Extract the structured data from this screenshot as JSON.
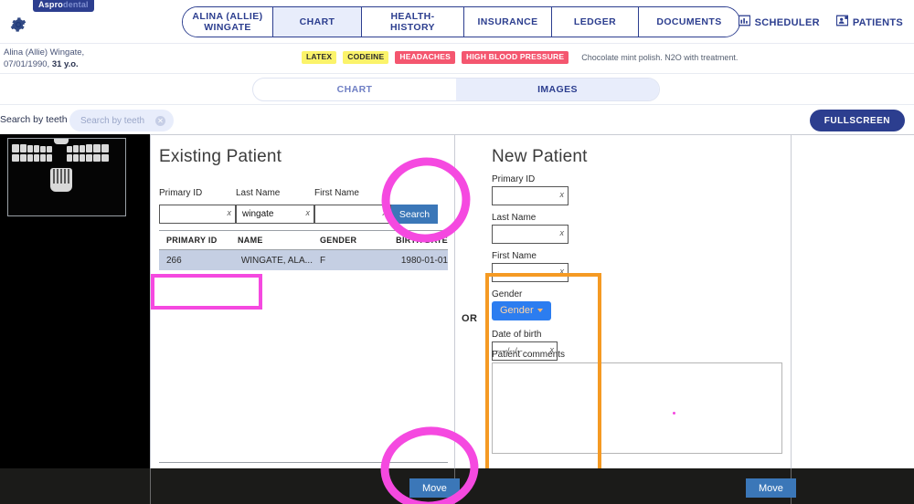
{
  "app": {
    "logo_bold": "Aspro",
    "logo_light": "dental"
  },
  "topnav": {
    "gear_icon": "gear-icon",
    "tabs": [
      {
        "label": "ALINA (ALLIE)\nWINGATE",
        "active": false
      },
      {
        "label": "CHART",
        "active": true
      },
      {
        "label": "HEALTH-HISTORY",
        "active": false
      },
      {
        "label": "INSURANCE",
        "active": false
      },
      {
        "label": "LEDGER",
        "active": false
      },
      {
        "label": "DOCUMENTS",
        "active": false
      }
    ],
    "right_actions": [
      {
        "label": "SCHEDULER",
        "icon": "calendar-icon"
      },
      {
        "label": "PATIENTS",
        "icon": "person-card-icon"
      }
    ]
  },
  "patient_bar": {
    "name_line1": "Alina (Allie) Wingate,",
    "dob": "07/01/1990, ",
    "age": "31 y.o.",
    "badges": [
      {
        "label": "LATEX",
        "color": "#fbf36a",
        "text_color": "#2c2c2c"
      },
      {
        "label": "CODEINE",
        "color": "#fbf36a",
        "text_color": "#2c2c2c"
      },
      {
        "label": "HEADACHES",
        "color": "#f4566f",
        "text_color": "#ffffff"
      },
      {
        "label": "HIGH BLOOD PRESSURE",
        "color": "#f4566f",
        "text_color": "#ffffff"
      }
    ],
    "note": "Chocolate mint polish. N2O with treatment."
  },
  "subtabs": [
    {
      "label": "CHART",
      "active": false
    },
    {
      "label": "IMAGES",
      "active": true
    }
  ],
  "search_row": {
    "label": "Search by teeth",
    "placeholder": "Search by teeth",
    "value": "",
    "clear_icon": "clear-icon",
    "fullscreen_label": "FULLSCREEN"
  },
  "existing_patient": {
    "title": "Existing Patient",
    "fields": [
      {
        "label": "Primary ID",
        "value": "",
        "clear": "x"
      },
      {
        "label": "Last Name",
        "value": "wingate",
        "clear": "x"
      },
      {
        "label": "First Name",
        "value": "",
        "clear": "x"
      }
    ],
    "search_button": "Search",
    "table": {
      "columns": [
        "PRIMARY ID",
        "NAME",
        "GENDER",
        "BIRTH DATE"
      ],
      "rows": [
        {
          "primary_id": "266",
          "name": "WINGATE, ALA...",
          "gender": "F",
          "birth_date": "1980-01-01"
        }
      ]
    }
  },
  "divider": {
    "or_label": "OR"
  },
  "new_patient": {
    "title": "New Patient",
    "fields": [
      {
        "label": "Primary ID",
        "value": "",
        "clear": "x"
      },
      {
        "label": "Last Name",
        "value": "",
        "clear": "x"
      },
      {
        "label": "First Name",
        "value": "",
        "clear": "x"
      }
    ],
    "gender_label": "Gender",
    "gender_button": "Gender",
    "dob_label": "Date of birth",
    "dob_value": "----/--/--",
    "dob_clear": "x",
    "comments_label": "Patient comments",
    "comments_value": ""
  },
  "bottom_bar": {
    "move_left_label": "Move",
    "move_right_label": "Move"
  },
  "annotations": {
    "colors": {
      "pink": "#f549e0",
      "orange": "#f59a23"
    }
  }
}
